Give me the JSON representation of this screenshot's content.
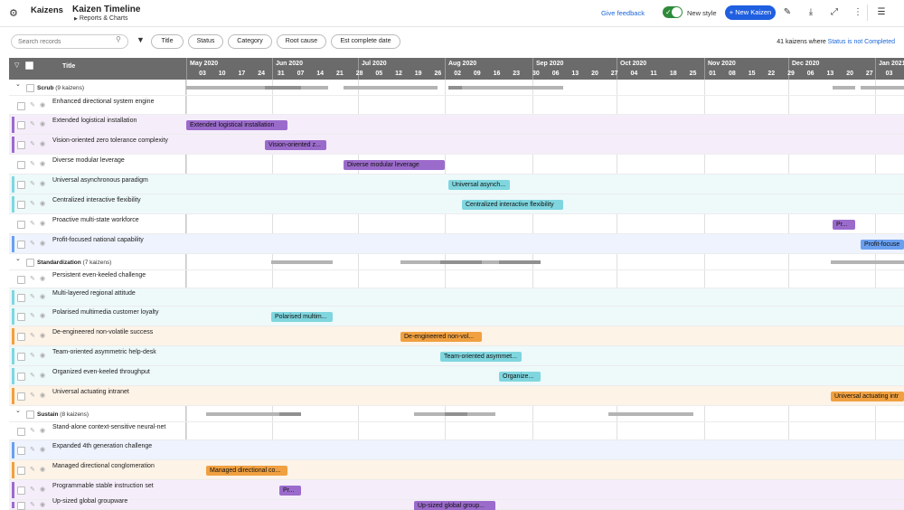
{
  "header": {
    "app_name": "Kaizens",
    "page_title": "Kaizen Timeline",
    "breadcrumb": "Reports & Charts",
    "give_feedback": "Give feedback",
    "new_style_label": "New style",
    "new_style_enabled": true,
    "new_kaizen_label": "+ New Kaizen",
    "icons": [
      "gear-icon",
      "edit-icon",
      "download-icon",
      "expand-icon",
      "more-icon",
      "settings-sliders-icon"
    ]
  },
  "toolbar": {
    "search_placeholder": "Search records",
    "filter_chips": [
      "Title",
      "Status",
      "Category",
      "Root cause",
      "Est complete date"
    ],
    "summary_count": "41 kaizens where",
    "summary_filter": "Status is not Completed"
  },
  "grid": {
    "title_column": "Title",
    "months": [
      "May 2020",
      "Jun 2020",
      "Jul 2020",
      "Aug 2020",
      "Sep 2020",
      "Oct 2020",
      "Nov 2020",
      "Dec 2020",
      "Jan 2021"
    ],
    "days": [
      "03",
      "10",
      "17",
      "24",
      "31",
      "07",
      "14",
      "21",
      "28",
      "05",
      "12",
      "19",
      "26",
      "02",
      "09",
      "16",
      "23",
      "30",
      "06",
      "13",
      "20",
      "27",
      "04",
      "11",
      "18",
      "25",
      "01",
      "08",
      "15",
      "22",
      "29",
      "06",
      "13",
      "20",
      "27",
      "03"
    ]
  },
  "colors": {
    "purple": "#9b6bcc",
    "cyan": "#7fd6df",
    "blue": "#6aa0ef",
    "orange": "#f0a040",
    "header_gray": "#6b6b6b",
    "accent_blue": "#1f5fe0",
    "toggle_green": "#2e8b3a"
  },
  "groups": [
    {
      "name": "Scrub",
      "count": "(9 kaizens)"
    },
    {
      "name": "Standardization",
      "count": "(7 kaizens)"
    },
    {
      "name": "Sustain",
      "count": "(8 kaizens)"
    }
  ],
  "rows": [
    {
      "title": "Enhanced directional system engine",
      "color": ""
    },
    {
      "title": "Extended logistical installation",
      "color": "purple",
      "bar": "Extended logistical installation"
    },
    {
      "title": "Vision-oriented zero tolerance complexity",
      "color": "purple",
      "bar": "Vision-oriented z..."
    },
    {
      "title": "Diverse modular leverage",
      "color": "",
      "bar": "Diverse modular leverage"
    },
    {
      "title": "Universal asynchronous paradigm",
      "color": "cyan",
      "bar": "Universal asynch..."
    },
    {
      "title": "Centralized interactive flexibility",
      "color": "cyan",
      "bar": "Centralized interactive flexibility"
    },
    {
      "title": "Proactive multi-state workforce",
      "color": "",
      "bar": "Pr..."
    },
    {
      "title": "Profit-focused national capability",
      "color": "blue",
      "bar": "Profit-focuse"
    },
    {
      "title": "Persistent even-keeled challenge",
      "color": ""
    },
    {
      "title": "Multi-layered regional attitude",
      "color": "cyan"
    },
    {
      "title": "Polarised multimedia customer loyalty",
      "color": "cyan",
      "bar": "Polarised multim..."
    },
    {
      "title": "De-engineered non-volatile success",
      "color": "orange",
      "bar": "De-engineered non-vol..."
    },
    {
      "title": "Team-oriented asymmetric help-desk",
      "color": "cyan",
      "bar": "Team-oriented asymmet..."
    },
    {
      "title": "Organized even-keeled throughput",
      "color": "cyan",
      "bar": "Organize..."
    },
    {
      "title": "Universal actuating intranet",
      "color": "orange",
      "bar": "Universal actuating intr"
    },
    {
      "title": "Stand-alone context-sensitive neural-net",
      "color": ""
    },
    {
      "title": "Expanded 4th generation challenge",
      "color": "blue"
    },
    {
      "title": "Managed directional conglomeration",
      "color": "orange",
      "bar": "Managed directional co..."
    },
    {
      "title": "Programmable stable instruction set",
      "color": "purple",
      "bar": "Pr..."
    },
    {
      "title": "Up-sized global groupware",
      "color": "purple",
      "bar": "Up-sized global group..."
    }
  ]
}
